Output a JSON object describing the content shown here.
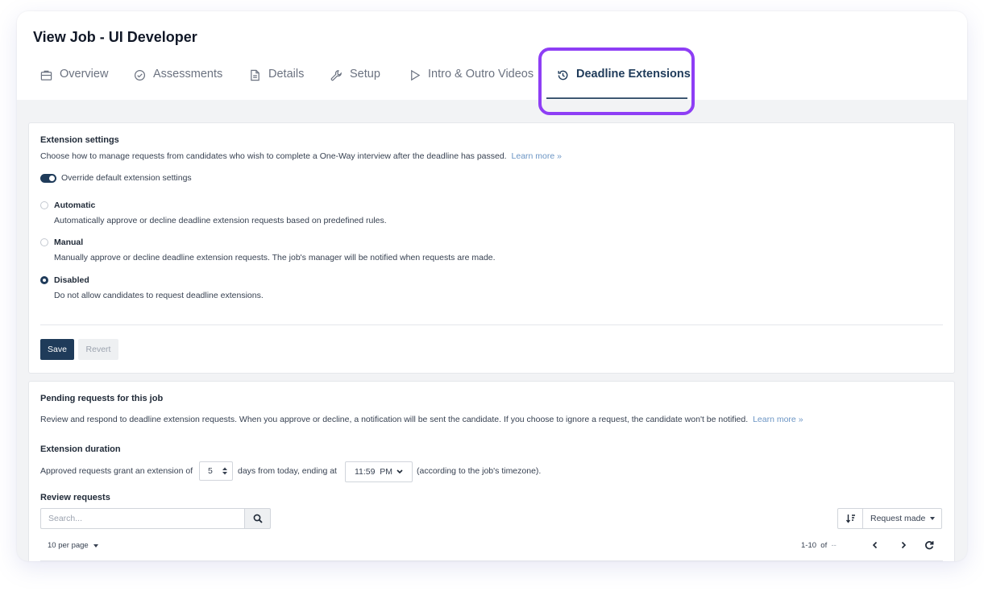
{
  "header": {
    "title": "View Job - UI Developer"
  },
  "tabs": [
    {
      "label": "Overview",
      "icon": "briefcase-icon"
    },
    {
      "label": "Assessments",
      "icon": "check-circle-icon"
    },
    {
      "label": "Details",
      "icon": "document-icon"
    },
    {
      "label": "Setup",
      "icon": "wrench-icon"
    },
    {
      "label": "Intro & Outro Videos",
      "icon": "play-icon"
    },
    {
      "label": "Deadline Extensions",
      "icon": "history-icon",
      "active": true
    }
  ],
  "extension_settings": {
    "heading": "Extension settings",
    "description": "Choose how to manage requests from candidates who wish to complete a One-Way interview after the deadline has passed.",
    "learn_more": "Learn more »",
    "override_label": "Override default extension settings",
    "override_on": true,
    "options": [
      {
        "label": "Automatic",
        "description": "Automatically approve or decline deadline extension requests based on predefined rules.",
        "selected": false
      },
      {
        "label": "Manual",
        "description": "Manually approve or decline deadline extension requests. The job's manager will be notified when requests are made.",
        "selected": false
      },
      {
        "label": "Disabled",
        "description": "Do not allow candidates to request deadline extensions.",
        "selected": true
      }
    ],
    "save_label": "Save",
    "revert_label": "Revert"
  },
  "pending": {
    "heading": "Pending requests for this job",
    "description": "Review and respond to deadline extension requests. When you approve or decline, a notification will be sent the candidate. If you choose to ignore a request, the candidate won't be notified.",
    "learn_more": "Learn more »",
    "duration_heading": "Extension duration",
    "duration_prefix": "Approved requests grant an extension of",
    "days_value": "5",
    "duration_middle": "days from today, ending at",
    "time_value": "11:59  PM",
    "duration_suffix": "(according to the job's timezone).",
    "review_heading": "Review requests",
    "search_placeholder": "Search...",
    "sort_label": "Request made",
    "per_page": "10 per page",
    "range": "1-10",
    "of_label": "of",
    "total": "--"
  },
  "colors": {
    "accent": "#8e3ef5",
    "primary": "#1f3b5a",
    "link": "#6b95c4"
  }
}
